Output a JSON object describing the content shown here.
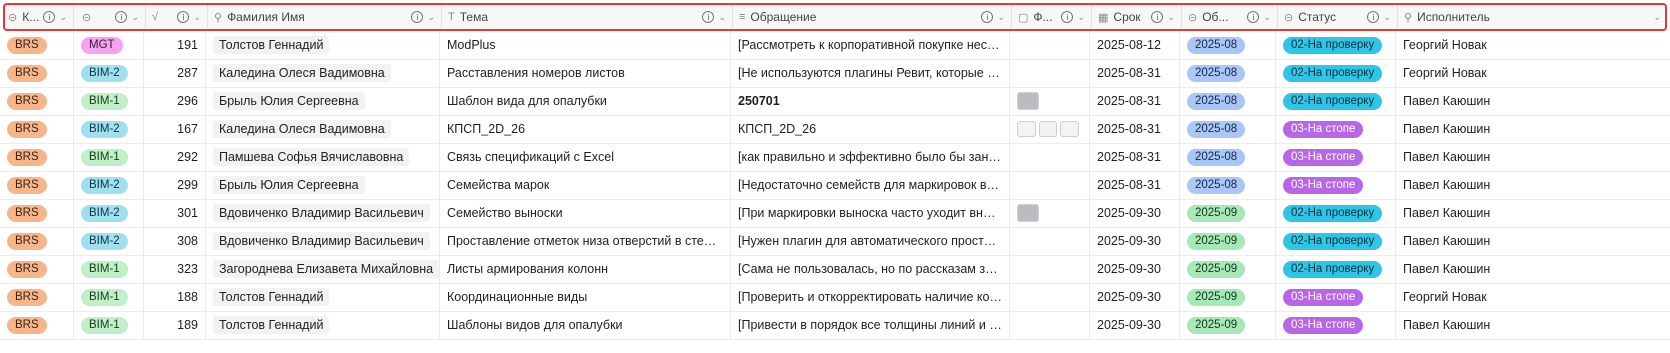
{
  "header": {
    "columns": [
      {
        "icon": "⊝",
        "label": "К...",
        "info": true
      },
      {
        "icon": "⊝",
        "label": "",
        "info": true
      },
      {
        "icon": "√",
        "label": "",
        "info": true
      },
      {
        "icon": "⚲",
        "label": "Фамилия Имя",
        "info": true
      },
      {
        "icon": "T",
        "label": "Тема",
        "info": true
      },
      {
        "icon": "≡",
        "label": "Обращение",
        "info": true
      },
      {
        "icon": "▢",
        "label": "Ф...",
        "info": true
      },
      {
        "icon": "▦",
        "label": "Срок",
        "info": true
      },
      {
        "icon": "⊝",
        "label": "Об...",
        "info": true
      },
      {
        "icon": "⊝",
        "label": "Статус",
        "info": true
      },
      {
        "icon": "⚲",
        "label": "Исполнитель",
        "info": false
      }
    ]
  },
  "colors": {
    "header_outline": "#e53935",
    "brs": "#f6b58b",
    "mgt": "#f5a3ee",
    "bim2": "#9fe0f0",
    "bim1": "#bff0c8",
    "month08": "#a9c6f7",
    "month09": "#a6e8b6",
    "status_check": "#2ec6e6",
    "status_stop": "#b866e8"
  },
  "rows": [
    {
      "company": "BRS",
      "dept": "MGT",
      "id": "191",
      "name": "Толстов Геннадий",
      "topic": "ModPlus",
      "request": "[Рассмотреть к корпоративной покупке неско...",
      "files": 0,
      "due": "2025-08-12",
      "month": "2025-08",
      "status": "02-На проверку",
      "assignee": "Георгий Новак"
    },
    {
      "company": "BRS",
      "dept": "BIM-2",
      "id": "287",
      "name": "Каледина Олеся Вадимовна",
      "topic": "Расставления номеров листов",
      "request": "[Не используются плагины Ревит, которые по...",
      "files": 0,
      "due": "2025-08-31",
      "month": "2025-08",
      "status": "02-На проверку",
      "assignee": "Георгий Новак"
    },
    {
      "company": "BRS",
      "dept": "BIM-1",
      "id": "296",
      "name": "Брыль Юлия Сергеевна",
      "topic": "Шаблон вида для опалубки",
      "request": "250701",
      "files": 1,
      "due": "2025-08-31",
      "month": "2025-08",
      "status": "02-На проверку",
      "assignee": "Павел Каюшин"
    },
    {
      "company": "BRS",
      "dept": "BIM-2",
      "id": "167",
      "name": "Каледина Олеся Вадимовна",
      "topic": "КПСП_2D_26",
      "request": "КПСП_2D_26",
      "files": 3,
      "due": "2025-08-31",
      "month": "2025-08",
      "status": "03-На стопе",
      "assignee": "Павел Каюшин"
    },
    {
      "company": "BRS",
      "dept": "BIM-1",
      "id": "292",
      "name": "Памшева Софья Вячиславовна",
      "topic": "Связь спецификаций с Excel",
      "request": "[как правильно и эффективно было бы заноси...",
      "files": 0,
      "due": "2025-08-31",
      "month": "2025-08",
      "status": "03-На стопе",
      "assignee": "Павел Каюшин"
    },
    {
      "company": "BRS",
      "dept": "BIM-2",
      "id": "299",
      "name": "Брыль Юлия Сергеевна",
      "topic": "Семейства марок",
      "request": "[Недостаточно семейств для маркировок все...",
      "files": 0,
      "due": "2025-08-31",
      "month": "2025-08",
      "status": "03-На стопе",
      "assignee": "Павел Каюшин"
    },
    {
      "company": "BRS",
      "dept": "BIM-2",
      "id": "301",
      "name": "Вдовиченко Владимир Васильевич",
      "topic": "Семейство выноски",
      "request": "[При маркировки выноска часто уходит вниз и...",
      "files": 1,
      "due": "2025-09-30",
      "month": "2025-09",
      "status": "02-На проверку",
      "assignee": "Павел Каюшин"
    },
    {
      "company": "BRS",
      "dept": "BIM-2",
      "id": "308",
      "name": "Вдовиченко Владимир Васильевич",
      "topic": "Проставление отметок низа отверстий в стенах",
      "request": "[Нужен плагин для автоматического проставл...",
      "files": 0,
      "due": "2025-09-30",
      "month": "2025-09",
      "status": "02-На проверку",
      "assignee": "Павел Каюшин"
    },
    {
      "company": "BRS",
      "dept": "BIM-1",
      "id": "323",
      "name": "Загороднева Елизавета Михайловна",
      "topic": "Листы армирования колонн",
      "request": "[Сама не пользовалась, но по рассказам знак...",
      "files": 0,
      "due": "2025-09-30",
      "month": "2025-09",
      "status": "02-На проверку",
      "assignee": "Павел Каюшин"
    },
    {
      "company": "BRS",
      "dept": "BIM-1",
      "id": "188",
      "name": "Толстов Геннадий",
      "topic": "Координационные виды",
      "request": "[Проверить и откорректировать наличие коор...",
      "files": 0,
      "due": "2025-09-30",
      "month": "2025-09",
      "status": "03-На стопе",
      "assignee": "Георгий Новак"
    },
    {
      "company": "BRS",
      "dept": "BIM-1",
      "id": "189",
      "name": "Толстов Геннадий",
      "topic": "Шаблоны видов для опалубки",
      "request": "[Привести в порядок все толщины линий и от...",
      "files": 0,
      "due": "2025-09-30",
      "month": "2025-09",
      "status": "03-На стопе",
      "assignee": "Павел Каюшин"
    }
  ]
}
